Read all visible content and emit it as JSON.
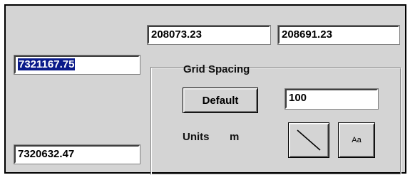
{
  "fields": {
    "x_min": "208073.23",
    "x_max": "208691.23",
    "y_max": "7321167.75",
    "y_min": "7320632.47"
  },
  "grid": {
    "title": "Grid Spacing",
    "default_label": "Default",
    "spacing_value": "100",
    "units_label": "Units",
    "units_value": "m",
    "font_button_label": "Aa"
  },
  "colors": {
    "selection": "#0a1a8a",
    "panel": "#d4d4d4"
  },
  "icons": {
    "line_style": "diagonal-line-icon"
  }
}
